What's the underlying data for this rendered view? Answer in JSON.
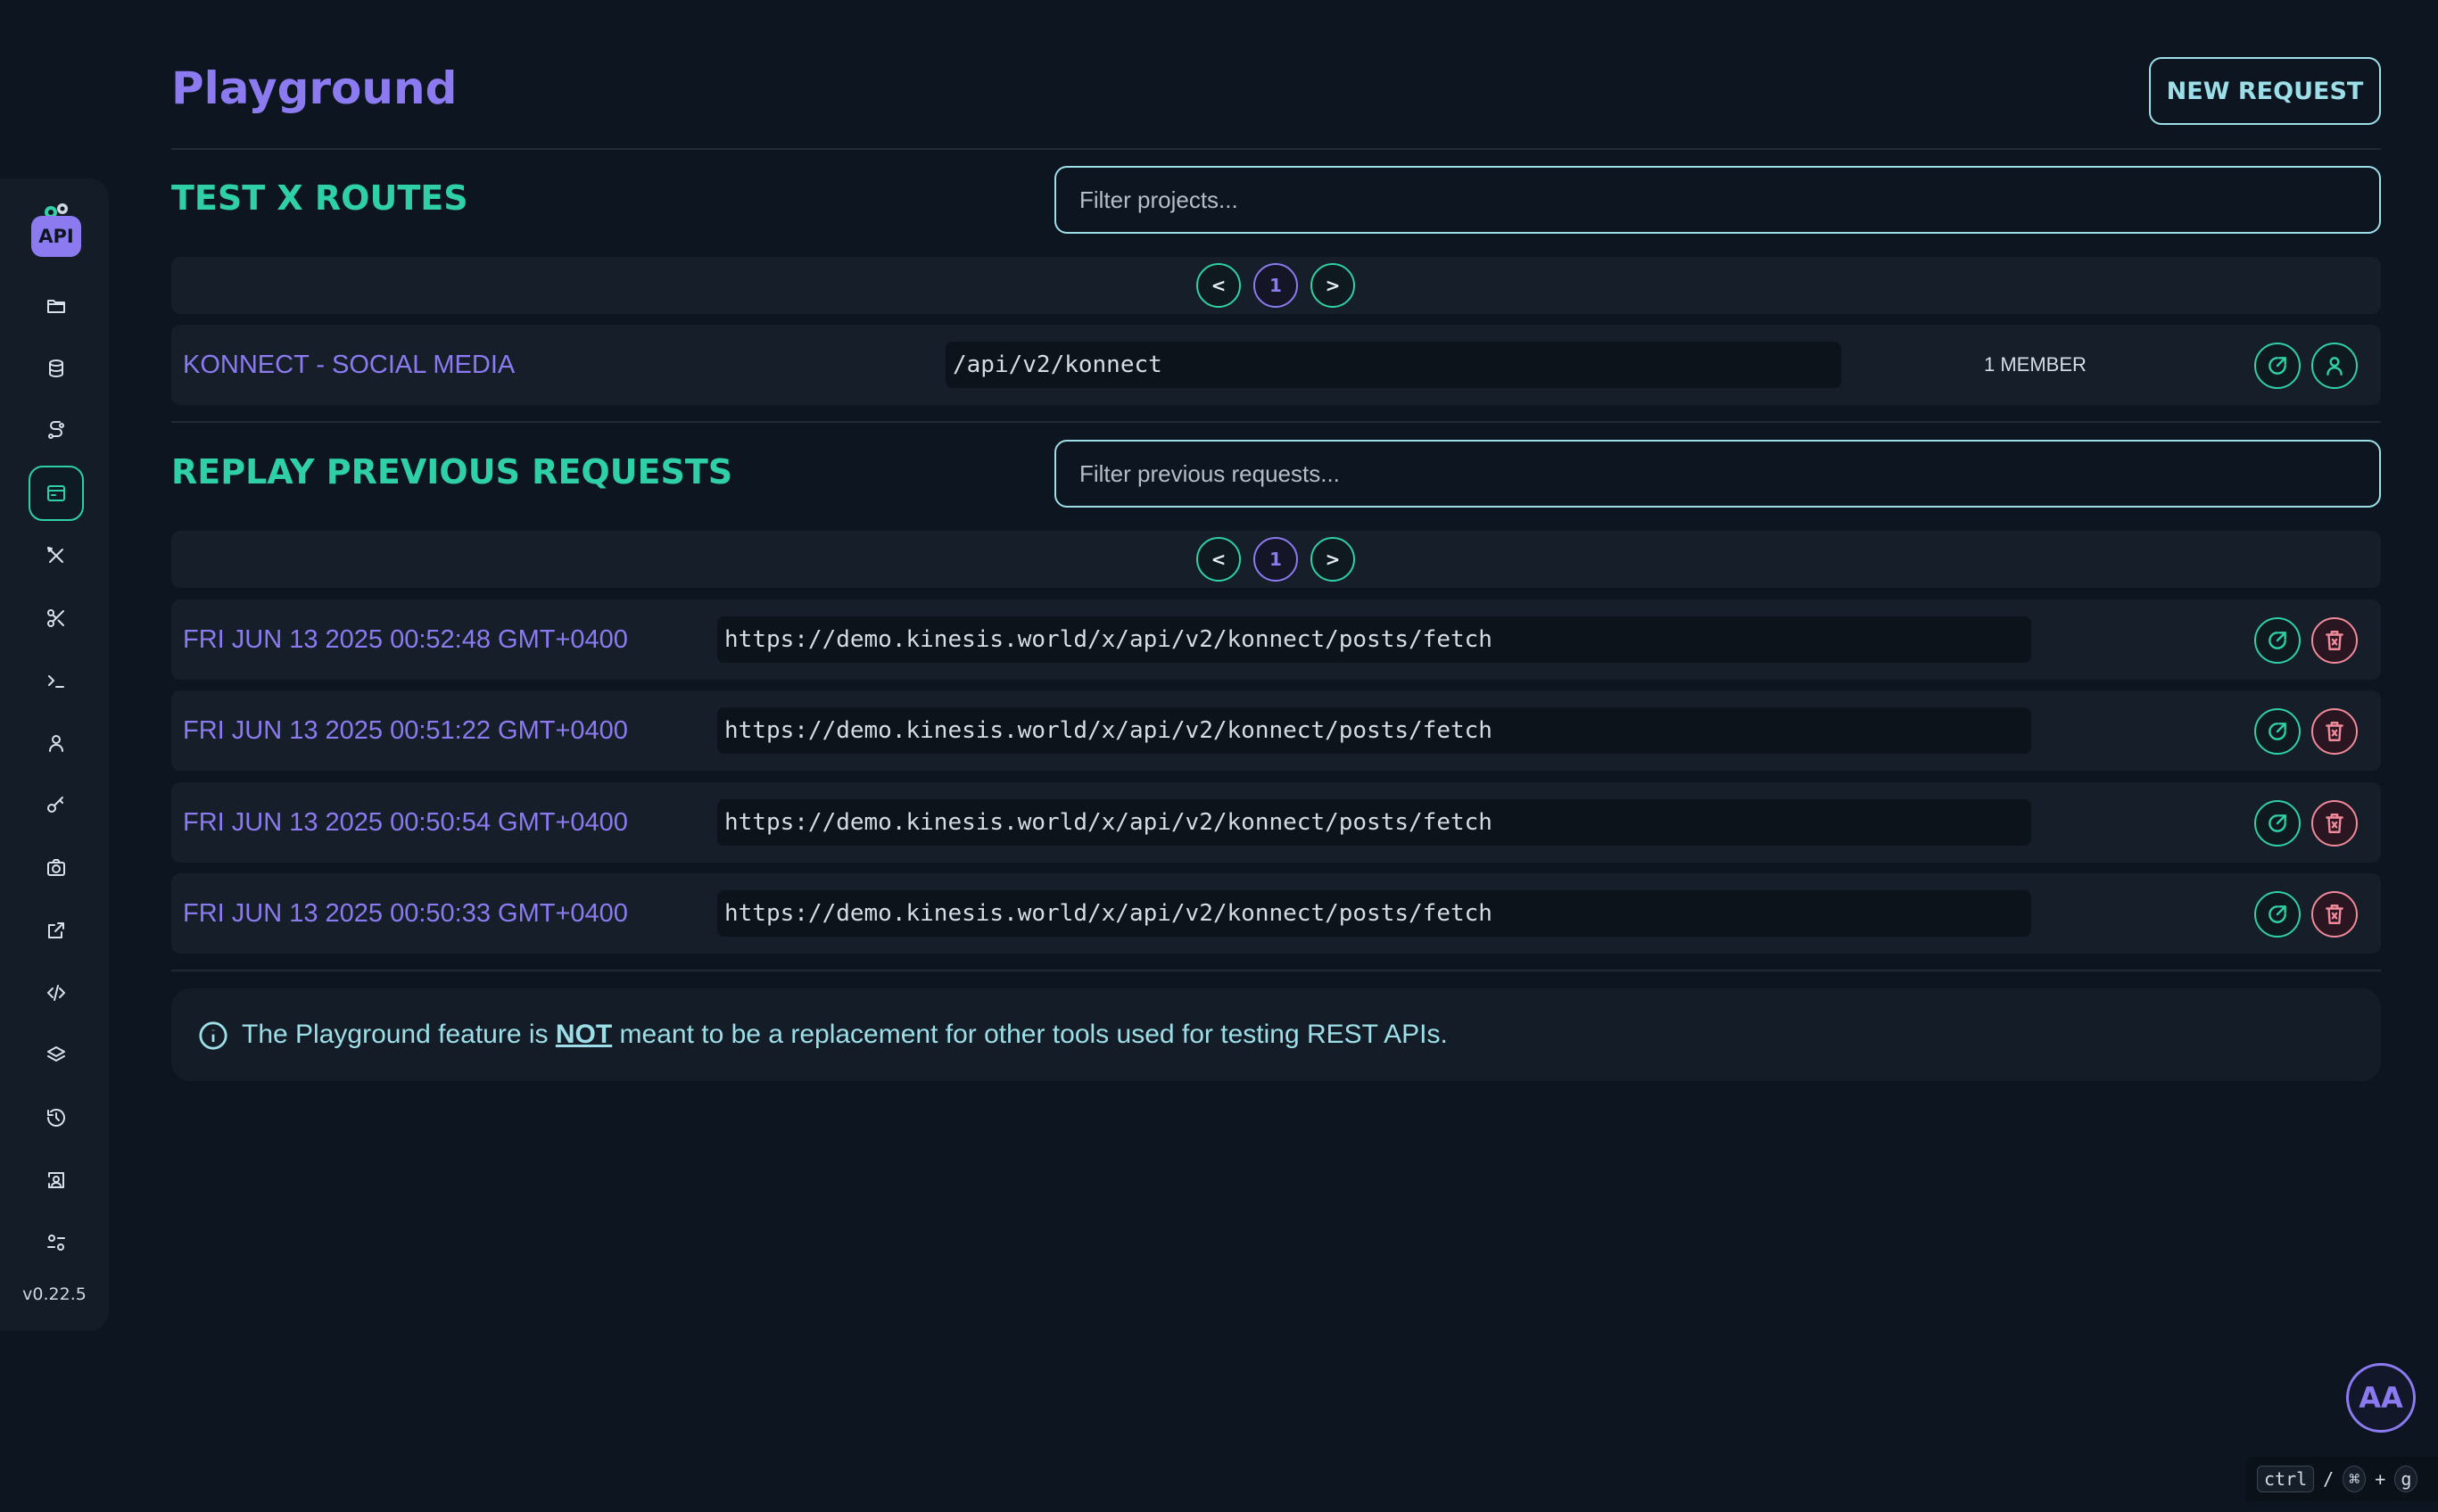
{
  "page": {
    "title": "Playground",
    "new_request_label": "NEW REQUEST"
  },
  "sidebar": {
    "logo_text": "API",
    "version": "v0.22.5",
    "items": [
      {
        "icon": "folder-icon"
      },
      {
        "icon": "database-icon"
      },
      {
        "icon": "routes-icon"
      },
      {
        "icon": "playground-icon",
        "active": true
      },
      {
        "icon": "tools-icon"
      },
      {
        "icon": "scissors-icon"
      },
      {
        "icon": "terminal-icon"
      },
      {
        "icon": "user-icon"
      },
      {
        "icon": "key-icon"
      },
      {
        "icon": "camera-icon"
      },
      {
        "icon": "external-link-icon"
      },
      {
        "icon": "code-icon"
      },
      {
        "icon": "layers-icon"
      },
      {
        "icon": "history-icon"
      },
      {
        "icon": "inspect-icon"
      },
      {
        "icon": "settings-icon"
      }
    ]
  },
  "projects": {
    "title": "TEST X ROUTES",
    "filter_placeholder": "Filter projects...",
    "pager": {
      "prev": "<",
      "page": "1",
      "next": ">"
    },
    "rows": [
      {
        "name": "KONNECT - SOCIAL MEDIA",
        "path": "/api/v2/konnect",
        "members": "1 MEMBER"
      }
    ]
  },
  "requests": {
    "title": "REPLAY PREVIOUS REQUESTS",
    "filter_placeholder": "Filter previous requests...",
    "pager": {
      "prev": "<",
      "page": "1",
      "next": ">"
    },
    "rows": [
      {
        "time": "FRI JUN 13 2025 00:52:48 GMT+0400",
        "url": "https://demo.kinesis.world/x/api/v2/konnect/posts/fetch"
      },
      {
        "time": "FRI JUN 13 2025 00:51:22 GMT+0400",
        "url": "https://demo.kinesis.world/x/api/v2/konnect/posts/fetch"
      },
      {
        "time": "FRI JUN 13 2025 00:50:54 GMT+0400",
        "url": "https://demo.kinesis.world/x/api/v2/konnect/posts/fetch"
      },
      {
        "time": "FRI JUN 13 2025 00:50:33 GMT+0400",
        "url": "https://demo.kinesis.world/x/api/v2/konnect/posts/fetch"
      }
    ]
  },
  "notice": {
    "before": "The Playground feature is ",
    "emphasis": "NOT",
    "after": " meant to be a replacement for other tools used for testing REST APIs."
  },
  "avatar": {
    "initials": "AA"
  },
  "shortcut": {
    "key1": "ctrl",
    "sep": "/",
    "key2": "⌘",
    "plus": "+",
    "key3": "g"
  },
  "colors": {
    "accent_purple": "#8c7af0",
    "accent_teal": "#2fd0a7",
    "danger": "#f08a9a",
    "background": "#0d1520"
  }
}
